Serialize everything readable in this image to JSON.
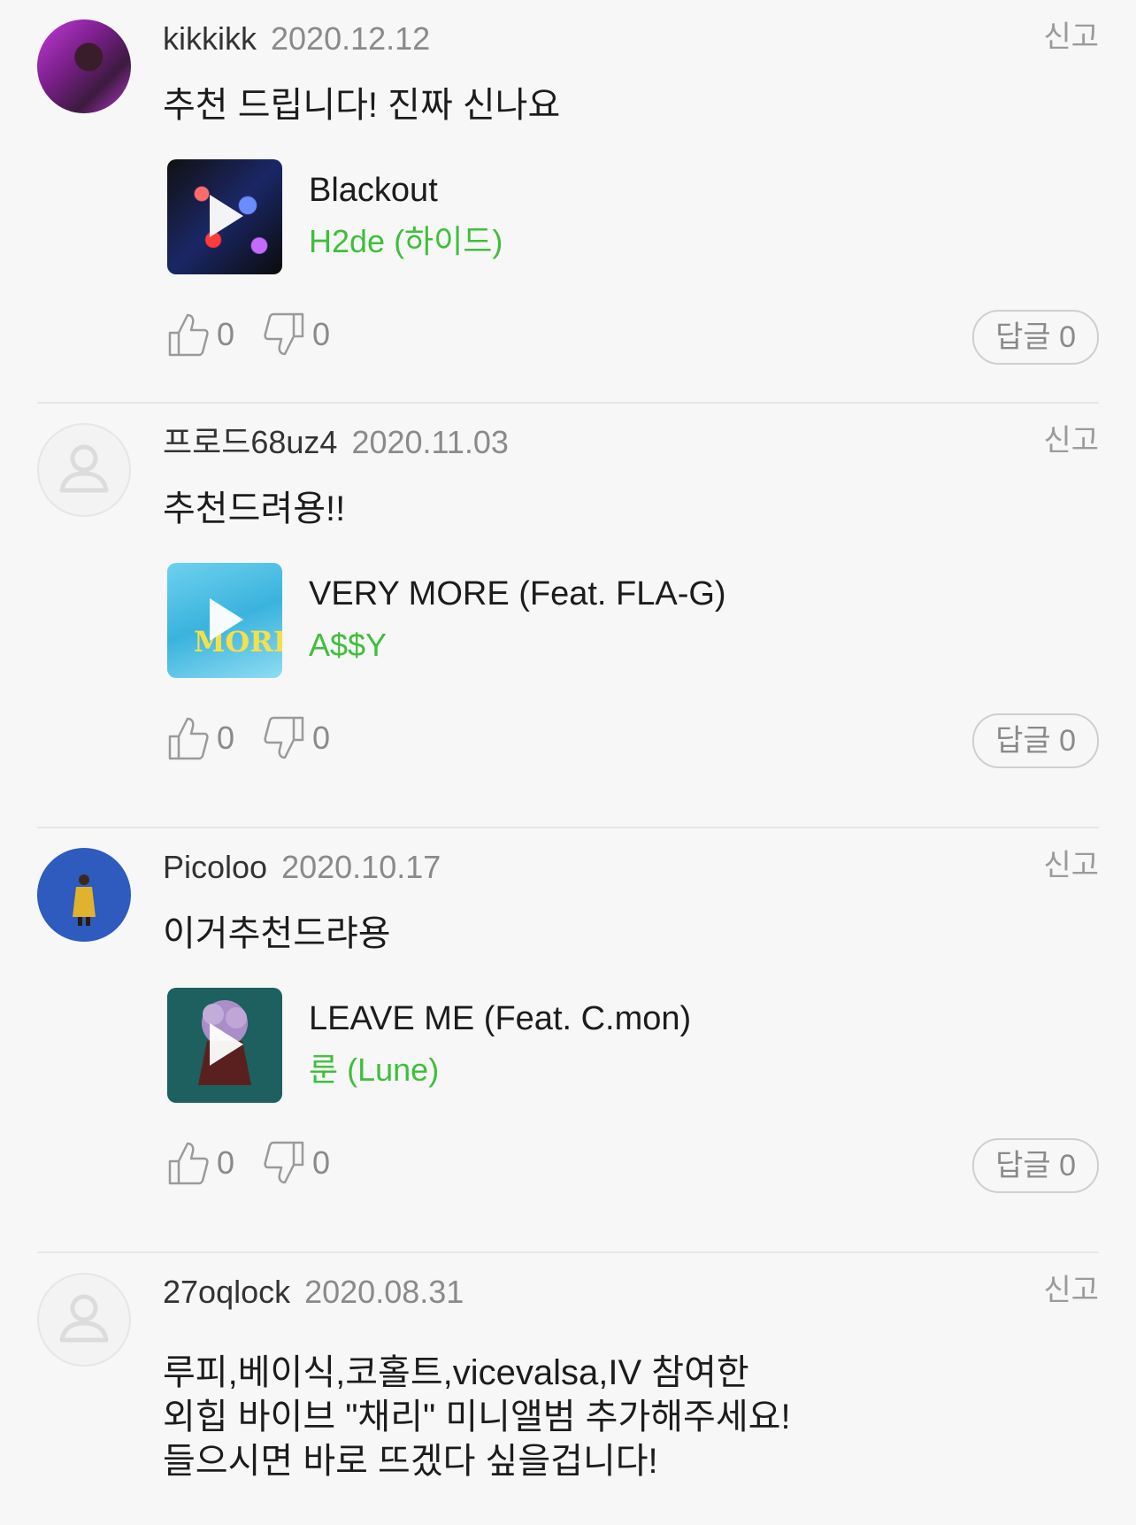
{
  "comments": [
    {
      "user": "kikkikk",
      "date": "2020.12.12",
      "report": "신고",
      "text": "추천 드립니다! 진짜 신나요",
      "track": {
        "title": "Blackout",
        "artist": "H2de (하이드)"
      },
      "likes": "0",
      "dislikes": "0",
      "reply": "답글 0"
    },
    {
      "user": "프로드68uz4",
      "date": "2020.11.03",
      "report": "신고",
      "text": "추천드려용!!",
      "track": {
        "title": "VERY MORE (Feat. FLA-G)",
        "artist": "A$$Y"
      },
      "likes": "0",
      "dislikes": "0",
      "reply": "답글 0"
    },
    {
      "user": "Picoloo",
      "date": "2020.10.17",
      "report": "신고",
      "text": "이거추천드랴용",
      "track": {
        "title": "LEAVE ME (Feat. C.mon)",
        "artist": "룬 (Lune)"
      },
      "likes": "0",
      "dislikes": "0",
      "reply": "답글 0"
    },
    {
      "user": "27oqlock",
      "date": "2020.08.31",
      "report": "신고",
      "text_lines": [
        "루피,베이식,코홀트,vicevalsa,IV 참여한",
        "외힙 바이브 \"채리\" 미니앨범 추가해주세요!",
        "들으시면 바로 뜨겠다 싶을겁니다!"
      ]
    }
  ],
  "icons": {
    "like": "thumbs-up-icon",
    "dislike": "thumbs-down-icon",
    "play": "play-icon",
    "default_avatar": "user-icon"
  },
  "colors": {
    "artist": "#3fbf3a",
    "background": "#f7f7f7"
  }
}
